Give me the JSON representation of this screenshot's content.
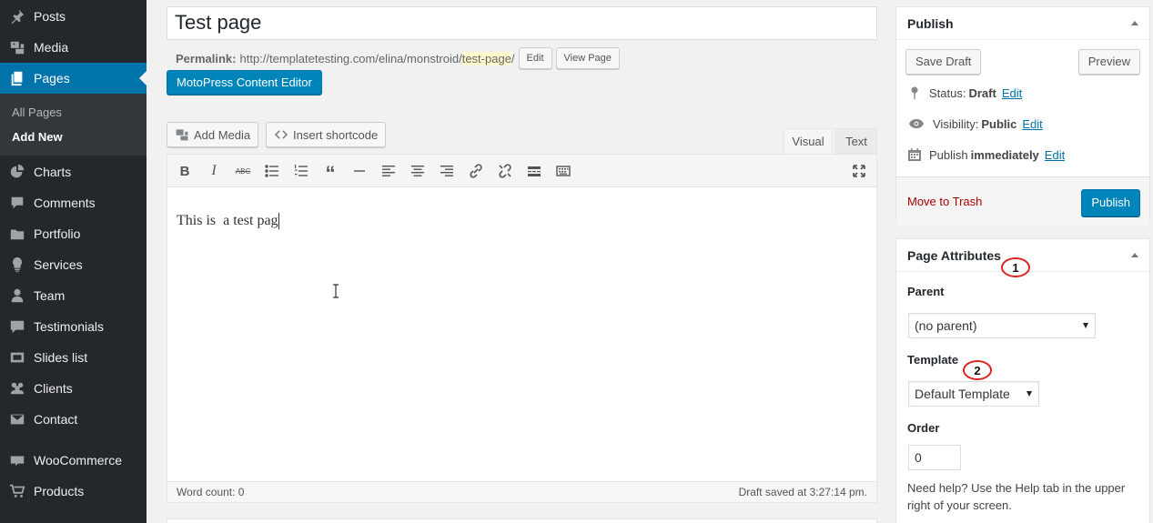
{
  "sidebar": {
    "items": [
      {
        "label": "Posts",
        "icon": "pushpin-icon"
      },
      {
        "label": "Media",
        "icon": "media-icon"
      },
      {
        "label": "Pages",
        "icon": "pages-icon",
        "active": true
      },
      {
        "label": "Charts",
        "icon": "pie-chart-icon"
      },
      {
        "label": "Comments",
        "icon": "comment-icon"
      },
      {
        "label": "Portfolio",
        "icon": "portfolio-icon"
      },
      {
        "label": "Services",
        "icon": "lightbulb-icon"
      },
      {
        "label": "Team",
        "icon": "user-icon"
      },
      {
        "label": "Testimonials",
        "icon": "testimonial-icon"
      },
      {
        "label": "Slides list",
        "icon": "slides-icon"
      },
      {
        "label": "Clients",
        "icon": "groups-icon"
      },
      {
        "label": "Contact",
        "icon": "email-icon"
      },
      {
        "label": "WooCommerce",
        "icon": "woo-icon"
      },
      {
        "label": "Products",
        "icon": "cart-icon"
      }
    ],
    "submenu": [
      "All Pages",
      "Add New"
    ]
  },
  "editor": {
    "title_value": "Test page",
    "permalink_label": "Permalink:",
    "permalink_base": "http://templatetesting.com/elina/monstroid/",
    "permalink_slug": "test-page",
    "permalink_tail": "/",
    "permalink_edit": "Edit",
    "view_page": "View Page",
    "motopress_button": "MotoPress Content Editor",
    "add_media": "Add Media",
    "insert_shortcode": "Insert shortcode",
    "tab_visual": "Visual",
    "tab_text": "Text",
    "content": "This is  a test pag",
    "word_count": "Word count: 0",
    "draft_saved": "Draft saved at 3:27:14 pm."
  },
  "publish": {
    "title": "Publish",
    "save_draft": "Save Draft",
    "preview": "Preview",
    "status_label": "Status:",
    "status_value": "Draft",
    "visibility_label": "Visibility:",
    "visibility_value": "Public",
    "publish_label": "Publish",
    "publish_value": "immediately",
    "edit": "Edit",
    "move_to_trash": "Move to Trash",
    "publish_button": "Publish"
  },
  "page_attributes": {
    "title": "Page Attributes",
    "parent_label": "Parent",
    "parent_value": "(no parent)",
    "template_label": "Template",
    "template_value": "Default Template",
    "order_label": "Order",
    "order_value": "0",
    "help_text": "Need help? Use the Help tab in the upper right of your screen."
  },
  "annotations": [
    "1",
    "2"
  ],
  "colors": {
    "sidebar_bg": "#23282d",
    "active_menu": "#0073aa",
    "primary_button": "#0085ba",
    "annotation_circle": "#e02020",
    "trash_link": "#a00"
  }
}
